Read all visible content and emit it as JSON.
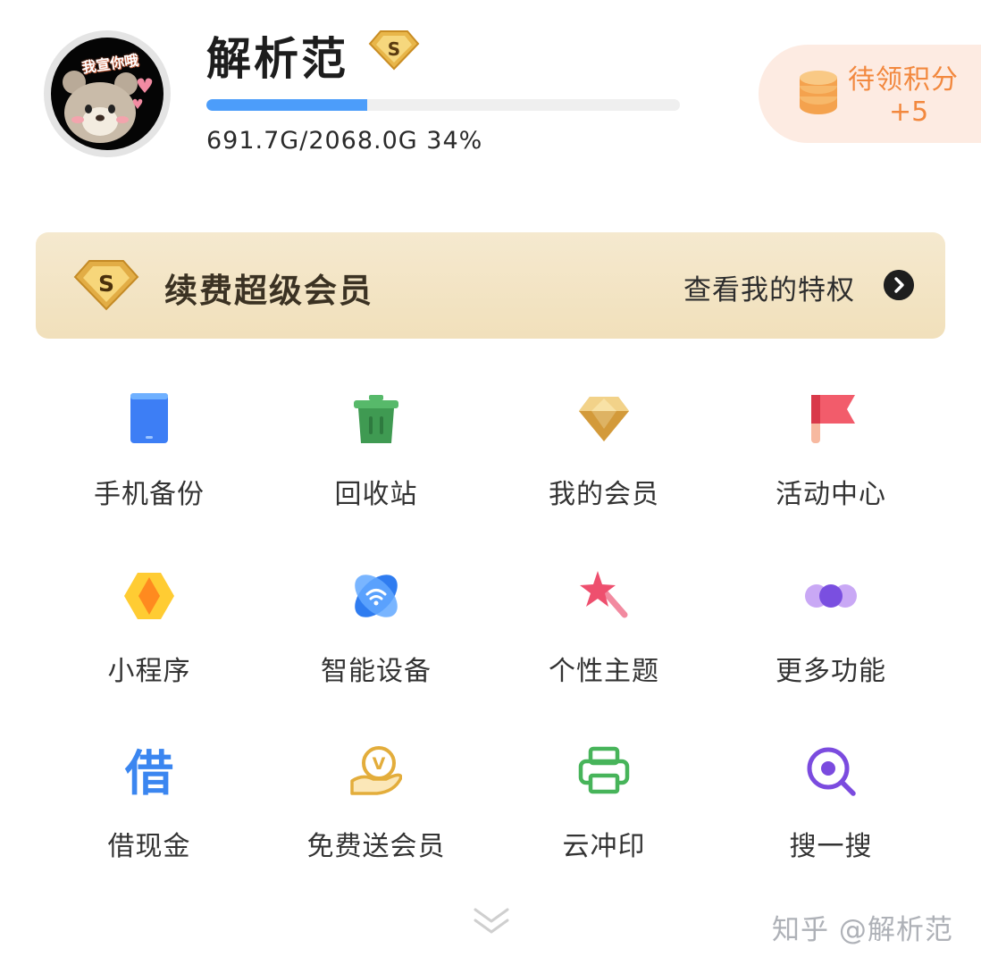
{
  "profile": {
    "avatar_sticker_text": "我宣你哦",
    "username": "解析范",
    "vip_badge_letter": "S",
    "storage_used_fraction": 0.34,
    "storage_text": "691.7G/2068.0G 34%"
  },
  "points": {
    "label": "待领积分",
    "count": "+5",
    "icon": "coin-stack-icon",
    "color": "#f2883e"
  },
  "banner": {
    "badge_letter": "S",
    "title": "续费超级会员",
    "link_label": "查看我的特权",
    "arrow_icon": "chevron-right-icon"
  },
  "grid": {
    "items": [
      {
        "label": "手机备份",
        "icon": "phone-backup-icon"
      },
      {
        "label": "回收站",
        "icon": "trash-icon"
      },
      {
        "label": "我的会员",
        "icon": "diamond-icon"
      },
      {
        "label": "活动中心",
        "icon": "flag-icon"
      },
      {
        "label": "小程序",
        "icon": "mini-program-icon"
      },
      {
        "label": "智能设备",
        "icon": "smart-device-icon"
      },
      {
        "label": "个性主题",
        "icon": "theme-wand-icon"
      },
      {
        "label": "更多功能",
        "icon": "more-dots-icon"
      },
      {
        "label": "借现金",
        "icon": "borrow-cash-icon",
        "glyph": "借"
      },
      {
        "label": "免费送会员",
        "icon": "free-vip-icon",
        "glyph": "V"
      },
      {
        "label": "云冲印",
        "icon": "printer-icon"
      },
      {
        "label": "搜一搜",
        "icon": "search-icon"
      }
    ]
  },
  "footer": {
    "expand_icon": "double-chevron-down-icon",
    "watermark": "知乎 @解析范"
  },
  "colors": {
    "accent_blue": "#4c9dfa",
    "banner_gold": "#f1e0bb",
    "points_orange": "#f2883e"
  }
}
